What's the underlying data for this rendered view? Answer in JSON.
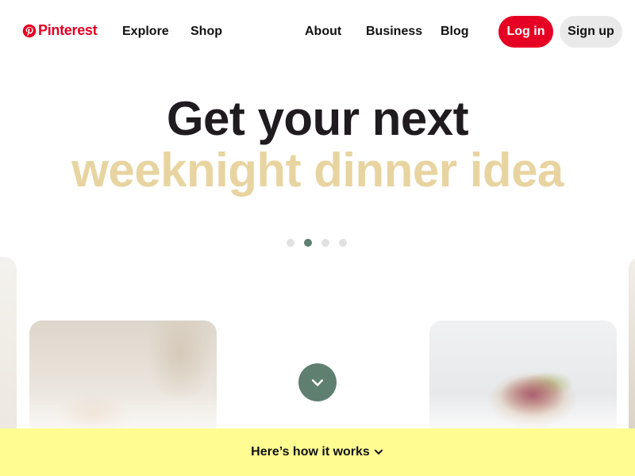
{
  "brand": {
    "name": "Pinterest",
    "color": "#e60023",
    "icon": "pinterest-logo-icon"
  },
  "nav": {
    "left": [
      {
        "label": "Explore"
      },
      {
        "label": "Shop"
      }
    ],
    "right": [
      {
        "label": "About"
      },
      {
        "label": "Business"
      },
      {
        "label": "Blog"
      }
    ]
  },
  "auth": {
    "login_label": "Log in",
    "signup_label": "Sign up"
  },
  "hero": {
    "line1": "Get your next",
    "line2": "weeknight dinner idea",
    "line2_color": "#e8d4a0",
    "active_slide": 2,
    "slide_count": 4,
    "accent_color": "#5f7f71"
  },
  "cards": [
    {
      "description": "person cooking in kitchen photo"
    },
    {
      "description": "beet hummus toast with avocado photo"
    }
  ],
  "scroll_button": {
    "icon": "chevron-down-icon"
  },
  "banner": {
    "text": "Here’s how it works",
    "icon": "chevron-down-icon",
    "color": "#fffd92"
  }
}
